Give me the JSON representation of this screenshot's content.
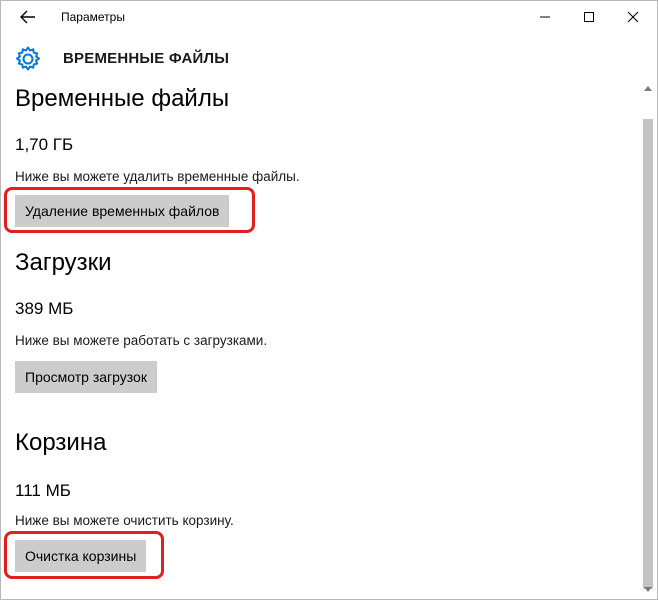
{
  "window": {
    "app_title": "Параметры",
    "page_title": "ВРЕМЕННЫЕ ФАЙЛЫ"
  },
  "icons": {
    "back": "back-arrow-icon",
    "gear": "gear-icon",
    "minimize": "minimize-icon",
    "maximize": "maximize-icon",
    "close": "close-icon"
  },
  "colors": {
    "accent": "#0078d7",
    "button_bg": "#cccccc",
    "highlight": "#e02020"
  },
  "sections": [
    {
      "title": "Временные файлы",
      "size": "1,70 ГБ",
      "description": "Ниже вы можете удалить временные файлы.",
      "button": "Удаление временных файлов"
    },
    {
      "title": "Загрузки",
      "size": "389 МБ",
      "description": "Ниже вы можете работать с загрузками.",
      "button": "Просмотр загрузок"
    },
    {
      "title": "Корзина",
      "size": "111 МБ",
      "description": "Ниже вы можете очистить корзину.",
      "button": "Очистка корзины"
    }
  ]
}
